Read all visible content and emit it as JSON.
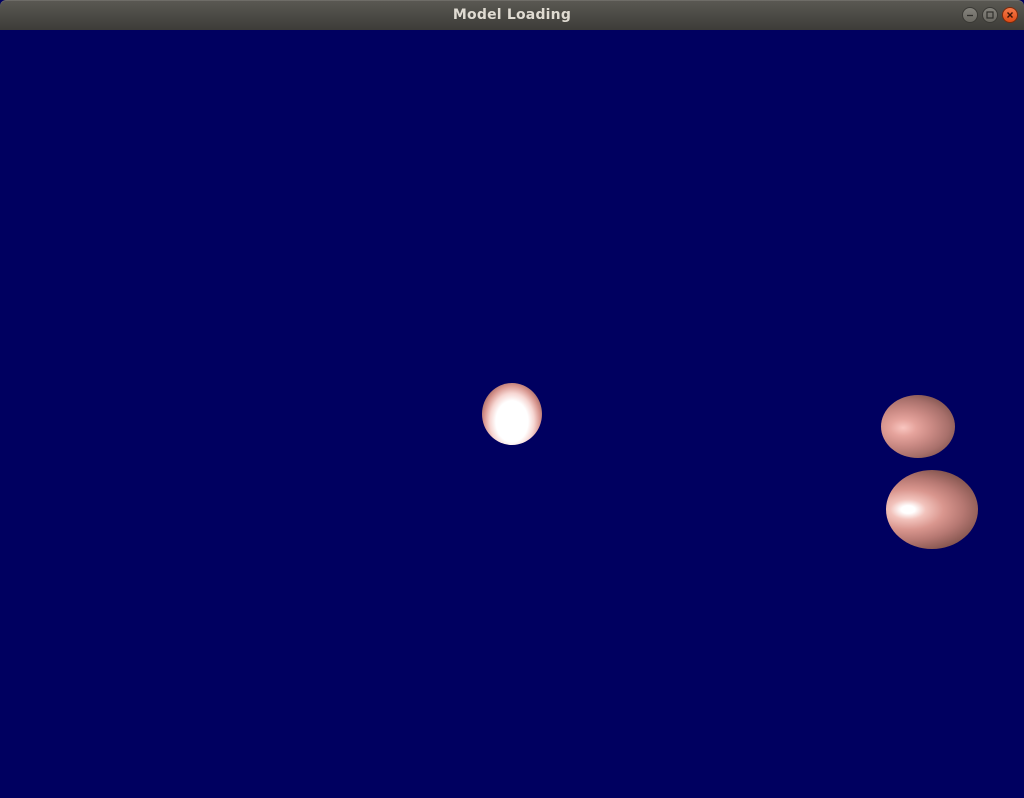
{
  "window": {
    "title": "Model Loading",
    "controls": {
      "minimize": "minimize-icon",
      "maximize": "maximize-icon",
      "close": "close-icon"
    }
  },
  "scene": {
    "background_color": "#000060",
    "objects": [
      {
        "name": "sphere",
        "color": "#d7958e",
        "lit": true
      },
      {
        "name": "sphere",
        "color": "#c98983"
      },
      {
        "name": "sphere",
        "color": "#d9968e"
      }
    ]
  }
}
